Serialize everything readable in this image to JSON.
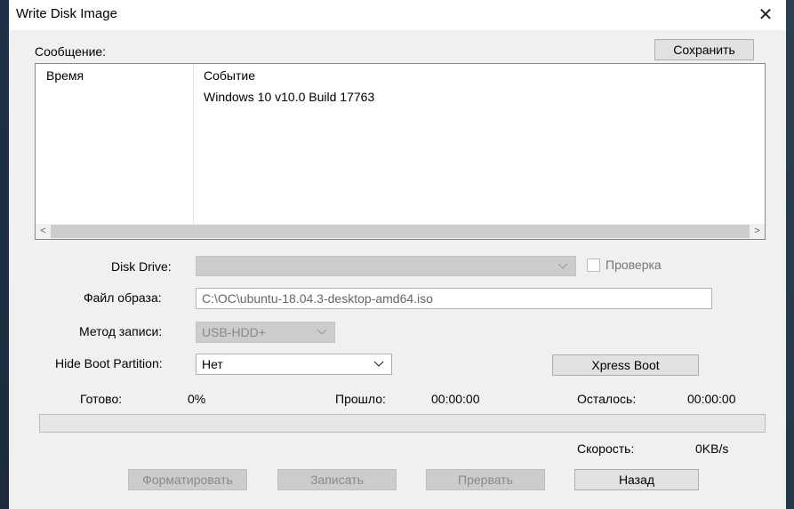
{
  "window": {
    "title": "Write Disk Image",
    "close_glyph": "✕"
  },
  "message": {
    "label": "Сообщение:",
    "save_button": "Сохранить",
    "columns": [
      "Время",
      "Событие"
    ],
    "rows": [
      {
        "time": "",
        "event": "Windows 10 v10.0 Build 17763"
      }
    ],
    "scroll_left": "<",
    "scroll_right": ">"
  },
  "form": {
    "disk_drive_label": "Disk Drive:",
    "disk_drive_value": "",
    "check_label": "Проверка",
    "check_checked": false,
    "image_file_label": "Файл образа:",
    "image_file_value": "C:\\OC\\ubuntu-18.04.3-desktop-amd64.iso",
    "write_method_label": "Метод записи:",
    "write_method_value": "USB-HDD+",
    "hide_boot_label": "Hide Boot Partition:",
    "hide_boot_value": "Нет",
    "xpress_boot_button": "Xpress Boot"
  },
  "status": {
    "done_label": "Готово:",
    "done_value": "0%",
    "elapsed_label": "Прошло:",
    "elapsed_value": "00:00:00",
    "remaining_label": "Осталось:",
    "remaining_value": "00:00:00",
    "speed_label": "Скорость:",
    "speed_value": "0KB/s",
    "progress_fraction": 0
  },
  "buttons": {
    "format": "Форматировать",
    "write": "Записать",
    "abort": "Прервать",
    "back": "Назад"
  },
  "colors": {
    "accent": "#0078d7",
    "dialog_bg": "#f0f0f0"
  }
}
